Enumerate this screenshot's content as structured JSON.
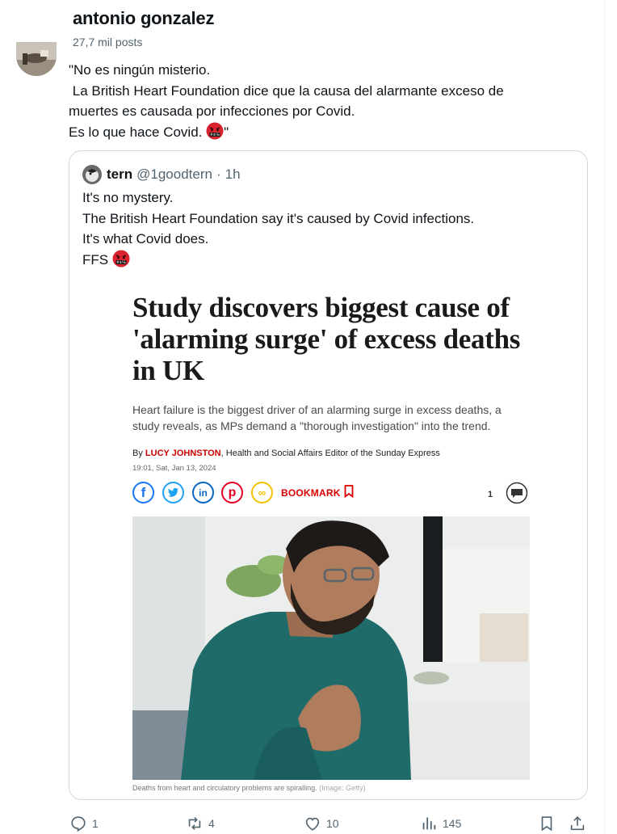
{
  "header": {
    "name": "antonio gonzalez",
    "post_count": "27,7 mil posts"
  },
  "post": {
    "lines": [
      "\"No es ningún misterio.",
      " La British Heart Foundation dice que la causa del alarmante exceso de",
      "muertes es causada por infecciones por Covid.",
      "Es lo que hace Covid. "
    ],
    "closing_quote": "\""
  },
  "quote": {
    "name": "tern",
    "handle": "@1goodtern",
    "separator": "·",
    "time": "1h",
    "lines": [
      "It's no mystery.",
      "The British Heart Foundation say it's caused by Covid infections.",
      "It's what Covid does.",
      "FFS "
    ],
    "article": {
      "headline": "Study discovers biggest cause of 'alarming surge' of excess deaths in UK",
      "standfirst": "Heart failure is the biggest driver of an alarming surge in excess deaths, a study reveals, as MPs demand a \"thorough investigation\" into the trend.",
      "byline_prefix": "By ",
      "author": "LUCY JOHNSTON",
      "byline_suffix": ", Health and Social Affairs Editor of the Sunday Express",
      "date": "19:01, Sat, Jan 13, 2024",
      "share_icons": [
        "facebook-icon",
        "twitter-icon",
        "linkedin-icon",
        "pinterest-icon",
        "link-icon"
      ],
      "share_glyphs": {
        "facebook": "f",
        "twitter": "t",
        "linkedin": "in",
        "pinterest": "p",
        "link": "∞"
      },
      "bookmark_label": "BOOKMARK",
      "comment_count": "1",
      "caption": "Deaths from heart and circulatory problems are spiralling.",
      "caption_credit": " (Image: Getty)"
    }
  },
  "actions": {
    "replies": "1",
    "reposts": "4",
    "likes": "10",
    "views": "145"
  },
  "colors": {
    "text": "#0f1419",
    "muted": "#536471",
    "border": "#cfd9de",
    "accent_red": "#d90000"
  }
}
